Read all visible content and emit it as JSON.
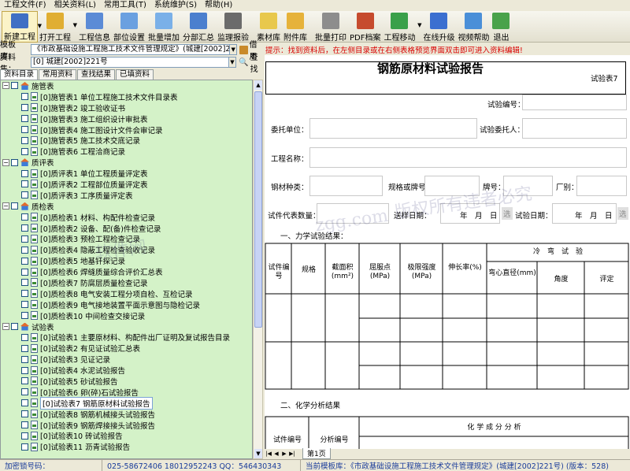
{
  "menu": [
    "工程文件(F)",
    "相关资料(L)",
    "常用工具(T)",
    "系统维护(S)",
    "帮助(H)"
  ],
  "toolbar": [
    {
      "label": "新建工程",
      "icon": "new-project-icon",
      "color": "#3f6fc4",
      "dropdown": true
    },
    {
      "label": "打开工程",
      "icon": "open-folder-icon",
      "color": "#e0ae32",
      "dropdown": true
    },
    {
      "label": "工程信息",
      "icon": "project-info-icon",
      "color": "#5b8bd6"
    },
    {
      "label": "部位设置",
      "icon": "part-setup-icon",
      "color": "#6aa0e0"
    },
    {
      "label": "批量增加",
      "icon": "batch-add-icon",
      "color": "#7ab0e8"
    },
    {
      "label": "分部汇总",
      "icon": "summary-icon",
      "color": "#4b7fce"
    },
    {
      "label": "监理报验",
      "icon": "supervision-icon",
      "color": "#6b6b6b"
    },
    {
      "label": "素材库",
      "icon": "material-library-icon",
      "color": "#e8c84c"
    },
    {
      "label": "附件库",
      "icon": "attachment-library-icon",
      "color": "#e6b23a"
    },
    {
      "label": "批量打印",
      "icon": "printer-icon",
      "color": "#8d8d8d"
    },
    {
      "label": "PDF档案",
      "icon": "pdf-archive-icon",
      "color": "#c64b2e"
    },
    {
      "label": "工程移动",
      "icon": "project-move-icon",
      "color": "#3aa04a",
      "dropdown": true
    },
    {
      "label": "在线升级",
      "icon": "online-upgrade-icon",
      "color": "#3b6fd0"
    },
    {
      "label": "视频帮助",
      "icon": "video-help-icon",
      "color": "#4a8fd8"
    },
    {
      "label": "退出",
      "icon": "exit-door-icon",
      "color": "#49a24a"
    }
  ],
  "template_row": {
    "label": "模板库：",
    "value": "《市政基础设施工程施工技术文件管理规定》(城建[2002]221号)",
    "button": "借用"
  },
  "dataset_row": {
    "label": "资料集：",
    "value": "[0] 城建[2002]221号",
    "button": "查找"
  },
  "notice": "提示：找到资料后，在左侧目录或在右侧表格预览界面双击即可进入资料编辑!",
  "tabs": [
    "资料目录",
    "常用资料",
    "查找结果",
    "已填资料"
  ],
  "tree": [
    {
      "type": "group",
      "label": "施管表"
    },
    {
      "type": "item",
      "label": "[0]施管表1   单位工程施工技术文件目录表"
    },
    {
      "type": "item",
      "label": "[0]施管表2   竣工验收证书"
    },
    {
      "type": "item",
      "label": "[0]施管表3   施工组织设计审批表"
    },
    {
      "type": "item",
      "label": "[0]施管表4   施工图设计文件会审记录"
    },
    {
      "type": "item",
      "label": "[0]施管表5   施工技术交底记录"
    },
    {
      "type": "item",
      "label": "[0]施管表6   工程洽商记录"
    },
    {
      "type": "group",
      "label": "质评表"
    },
    {
      "type": "item",
      "label": "[0]质评表1   单位工程质量评定表"
    },
    {
      "type": "item",
      "label": "[0]质评表2   工程部位质量评定表"
    },
    {
      "type": "item",
      "label": "[0]质评表3   工序质量评定表"
    },
    {
      "type": "group",
      "label": "质检表"
    },
    {
      "type": "item",
      "label": "[0]质检表1   材料、构配件检查记录"
    },
    {
      "type": "item",
      "label": "[0]质检表2   设备、配(备)件检查记录"
    },
    {
      "type": "item",
      "label": "[0]质检表3   预检工程检查记录"
    },
    {
      "type": "item",
      "label": "[0]质检表4   隐蔽工程检查验收记录"
    },
    {
      "type": "item",
      "label": "[0]质检表5   地基钎探记录"
    },
    {
      "type": "item",
      "label": "[0]质检表6   焊缝质量综合评价汇总表"
    },
    {
      "type": "item",
      "label": "[0]质检表7   防腐层质量检查记录"
    },
    {
      "type": "item",
      "label": "[0]质检表8   电气安装工程分项自检、互检记录"
    },
    {
      "type": "item",
      "label": "[0]质检表9   电气接地装置平面示意图与隐检记录"
    },
    {
      "type": "item",
      "label": "[0]质检表10   中间检查交接记录"
    },
    {
      "type": "group",
      "label": "试验表"
    },
    {
      "type": "item",
      "label": "[0]试验表1   主要原材料、构配件出厂证明及复试报告目录"
    },
    {
      "type": "item",
      "label": "[0]试验表2   有见证试验汇总表"
    },
    {
      "type": "item",
      "label": "[0]试验表3   见证记录"
    },
    {
      "type": "item",
      "label": "[0]试验表4   水泥试验报告"
    },
    {
      "type": "item",
      "label": "[0]试验表5   砂试验报告"
    },
    {
      "type": "item",
      "label": "[0]试验表6   卵(碎)石试验报告"
    },
    {
      "type": "item",
      "label": "[0]试验表7   钢筋原材料试验报告",
      "selected": true
    },
    {
      "type": "item",
      "label": "[0]试验表8   钢筋机械接头试验报告"
    },
    {
      "type": "item",
      "label": "[0]试验表9   钢筋焊接接头试验报告"
    },
    {
      "type": "item",
      "label": "[0]试验表10   砖试验报告"
    },
    {
      "type": "item",
      "label": "[0]试验表11   沥青试验报告"
    }
  ],
  "report": {
    "title": "钢筋原材料试验报告",
    "form_no": "试验表7",
    "test_no_label": "试验编号：",
    "client_label": "委托单位：",
    "client_person_label": "试验委托人：",
    "project_label": "工程名称：",
    "steel_type_label": "钢材种类：",
    "spec_label": "规格或牌号",
    "grade_label": "牌号：",
    "factory_label": "厂别：",
    "qty_label": "试件代表数量：",
    "sample_date_label": "送样日期：",
    "test_date_label": "试验日期：",
    "date_fmt": "年　月　日",
    "date_btn": "选",
    "section1": "一、力学试验结果：",
    "section2": "二、化学分析结果",
    "mech_headers": [
      "试件编号",
      "规格",
      "截面积(mm²)",
      "屈服点(MPa)",
      "极限强度(MPa)",
      "伸长率(%)"
    ],
    "bend_header": "冷　弯　试　验",
    "bend_sub": [
      "弯心直径(mm)",
      "角度",
      "评定"
    ],
    "chem_headers": [
      "试件编号",
      "分析编号"
    ],
    "chem_group": "化 学 成 分 分 析"
  },
  "page_tab": "第1页",
  "status": {
    "lock": "加密锁号码：",
    "phone": "025-58672406 18012952243  QQ：546430343",
    "template": "当前模板库：《市政基础设施工程施工技术文件管理规定》(城建[2002]221号)  (版本：528)"
  },
  "watermark": [
    "zgg.com",
    "版权所有违者必究",
    "软件网"
  ]
}
